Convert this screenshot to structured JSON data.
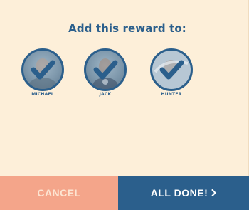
{
  "dialog": {
    "title": "Add this reward to:"
  },
  "kids": [
    {
      "name": "MICHAEL",
      "selected": true
    },
    {
      "name": "JACK",
      "selected": true
    },
    {
      "name": "HUNTER",
      "selected": true
    }
  ],
  "footer": {
    "cancel_label": "CANCEL",
    "done_label": "ALL DONE!"
  },
  "colors": {
    "background": "#fdefd9",
    "accent": "#2b5f8c",
    "cancel": "#f4a58a"
  }
}
